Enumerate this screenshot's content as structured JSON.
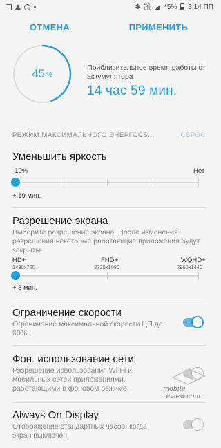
{
  "status_bar": {
    "signal": "4G",
    "signal_sub": "LTE",
    "battery": "45%",
    "time": "3:14 ПП",
    "icons": [
      "image-icon",
      "telegram-icon",
      "instagram-icon",
      "more-dots-icon",
      "bluetooth-icon",
      "signal-icon",
      "battery-icon"
    ]
  },
  "actions": {
    "cancel": "ОТМЕНА",
    "apply": "ПРИМЕНИТЬ"
  },
  "battery_card": {
    "percent_value": "45",
    "percent_unit": "%",
    "percent_fraction": 0.45,
    "estimate_label": "Приблизительное время работы от аккумулятора",
    "estimate_value": "14 час 59 мин."
  },
  "section": {
    "title": "РЕЖИМ МАКСИМАЛЬНОГО ЭНЕРГОСБ...",
    "reset": "СБРОС"
  },
  "brightness": {
    "title": "Уменьшить яркость",
    "min_label": "-10%",
    "max_label": "Нет",
    "gain": "+ 19 мин.",
    "level_fraction": 0
  },
  "resolution": {
    "title": "Разрешение экрана",
    "description": "Выберите разрешение экрана. После изменения разрешения некоторые работающие приложения будут закрыты.",
    "options": [
      {
        "name": "HD+",
        "size": "1480x720"
      },
      {
        "name": "FHD+",
        "size": "2220x1080"
      },
      {
        "name": "WQHD+",
        "size": "2960x1440"
      }
    ],
    "selected_index": 0,
    "gain": "+ 8 мин."
  },
  "cpu_limit": {
    "title": "Ограничение скорости",
    "description": "Ограничение максимальной скорости ЦП до 60%.",
    "enabled": true
  },
  "background_data": {
    "title": "Фон. использование сети",
    "description": "Разрешение использования Wi-Fi и мобильных сетей приложениями, работающими в фоновом режиме.",
    "enabled": false
  },
  "aod": {
    "title": "Always On Display",
    "description": "Отображение стандартных часов, когда экран выключен.",
    "enabled": false
  },
  "watermark": {
    "text": "mobile-review.com"
  },
  "colors": {
    "accent": "#2a9fd6",
    "background": "#f5f5f5"
  }
}
